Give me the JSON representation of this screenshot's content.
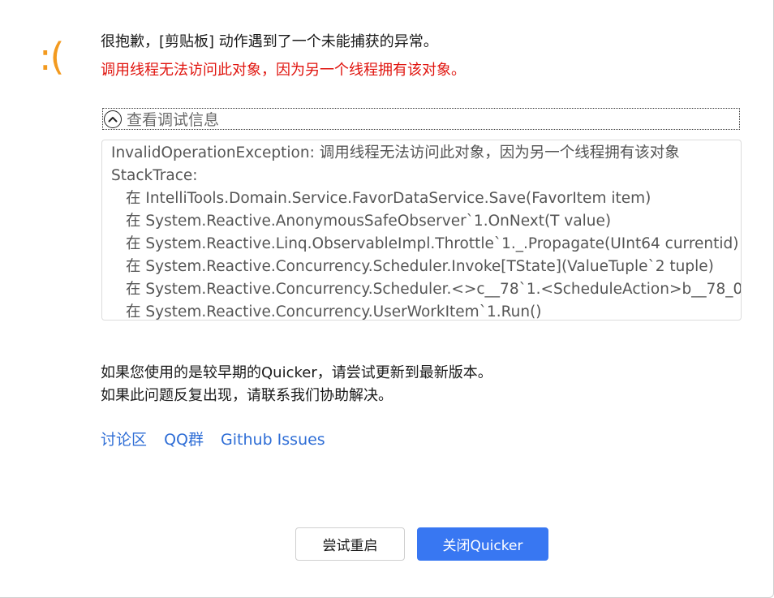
{
  "dialog": {
    "sad_face": ":(",
    "title": "很抱歉，[剪贴板] 动作遇到了一个未能捕获的异常。",
    "subtitle": "调用线程无法访问此对象，因为另一个线程拥有该对象。"
  },
  "debug": {
    "toggle_label": "查看调试信息",
    "expanded": true,
    "lines": [
      "InvalidOperationException: 调用线程无法访问此对象，因为另一个线程拥有该对象",
      "StackTrace:",
      "在 IntelliTools.Domain.Service.FavorDataService.Save(FavorItem item)",
      "在 System.Reactive.AnonymousSafeObserver`1.OnNext(T value)",
      "在 System.Reactive.Linq.ObservableImpl.Throttle`1._.Propagate(UInt64 currentid)",
      "在 System.Reactive.Concurrency.Scheduler.Invoke[TState](ValueTuple`2 tuple)",
      "在 System.Reactive.Concurrency.Scheduler.<>c__78`1.<ScheduleAction>b__78_0",
      "在 System.Reactive.Concurrency.UserWorkItem`1.Run()"
    ]
  },
  "help": {
    "line1": "如果您使用的是较早期的Quicker，请尝试更新到最新版本。",
    "line2": "如果此问题反复出现，请联系我们协助解决。"
  },
  "links": {
    "forum": "讨论区",
    "qq": "QQ群",
    "github": "Github Issues"
  },
  "buttons": {
    "retry": "尝试重启",
    "close": "关闭Quicker"
  },
  "colors": {
    "sad_face": "#f39a1f",
    "error_text": "#e0130d",
    "link": "#2f6ed6",
    "primary_button": "#3877f2"
  }
}
